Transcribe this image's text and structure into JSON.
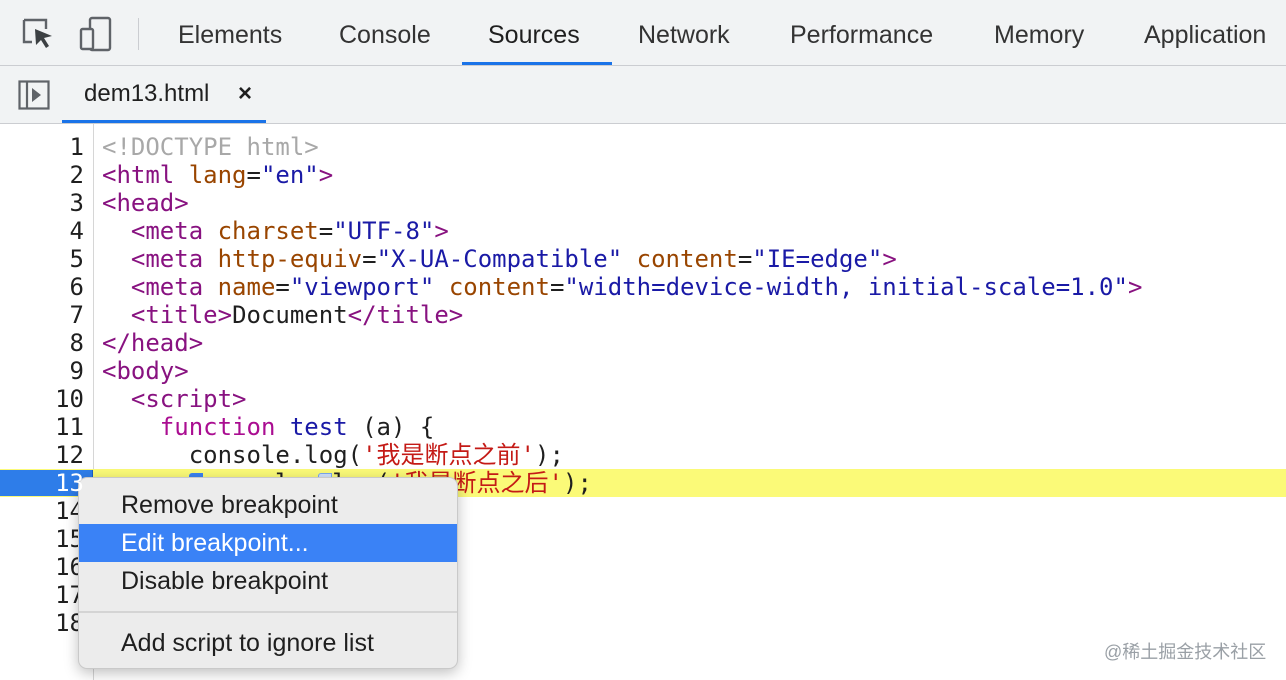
{
  "devtools": {
    "tabs": [
      "Elements",
      "Console",
      "Sources",
      "Network",
      "Performance",
      "Memory",
      "Application"
    ],
    "active_tab": "Sources",
    "toolbar_icons": [
      "inspect-element-icon",
      "device-toolbar-icon"
    ]
  },
  "sources": {
    "file_tab": "dem13.html",
    "file_close": "×",
    "navigator_icon": "navigator-toggle-icon",
    "lines": [
      {
        "n": "1"
      },
      {
        "n": "2"
      },
      {
        "n": "3"
      },
      {
        "n": "4"
      },
      {
        "n": "5"
      },
      {
        "n": "6"
      },
      {
        "n": "7"
      },
      {
        "n": "8"
      },
      {
        "n": "9"
      },
      {
        "n": "10"
      },
      {
        "n": "11"
      },
      {
        "n": "12"
      },
      {
        "n": "13"
      },
      {
        "n": "14"
      },
      {
        "n": "15"
      },
      {
        "n": "16"
      },
      {
        "n": "17"
      },
      {
        "n": "18"
      }
    ],
    "code": {
      "l1_doctype": "<!DOCTYPE html>",
      "l2_open": "<html",
      "l2_attr": "lang",
      "l2_eq": "=",
      "l2_val": "\"en\"",
      "l2_close": ">",
      "l3": "<head>",
      "l4_open": "<meta",
      "l4_attr": "charset",
      "l4_val": "\"UTF-8\"",
      "l5_attr1": "http-equiv",
      "l5_val1": "\"X-UA-Compatible\"",
      "l5_attr2": "content",
      "l5_val2": "\"IE=edge\"",
      "l6_attr1": "name",
      "l6_val1": "\"viewport\"",
      "l6_attr2": "content",
      "l6_val2": "\"width=device-width, initial-scale=1.0\"",
      "l7_open": "<title>",
      "l7_text": "Document",
      "l7_close": "</title>",
      "l8": "</head>",
      "l9": "<body>",
      "l10": "<script>",
      "l11_kw": "function",
      "l11_name": "test",
      "l11_rest": " (a) {",
      "l12_pre": "console.log(",
      "l12_str": "'我是断点之前'",
      "l12_post": ");",
      "l13_a": "console.",
      "l13_b": "log(",
      "l13_str": "'我是断点之后'",
      "l13_post": ");"
    }
  },
  "context_menu": {
    "items": [
      "Remove breakpoint",
      "Edit breakpoint...",
      "Disable breakpoint",
      "Add script to ignore list"
    ],
    "selected": "Edit breakpoint..."
  },
  "watermark": "@稀土掘金技术社区"
}
